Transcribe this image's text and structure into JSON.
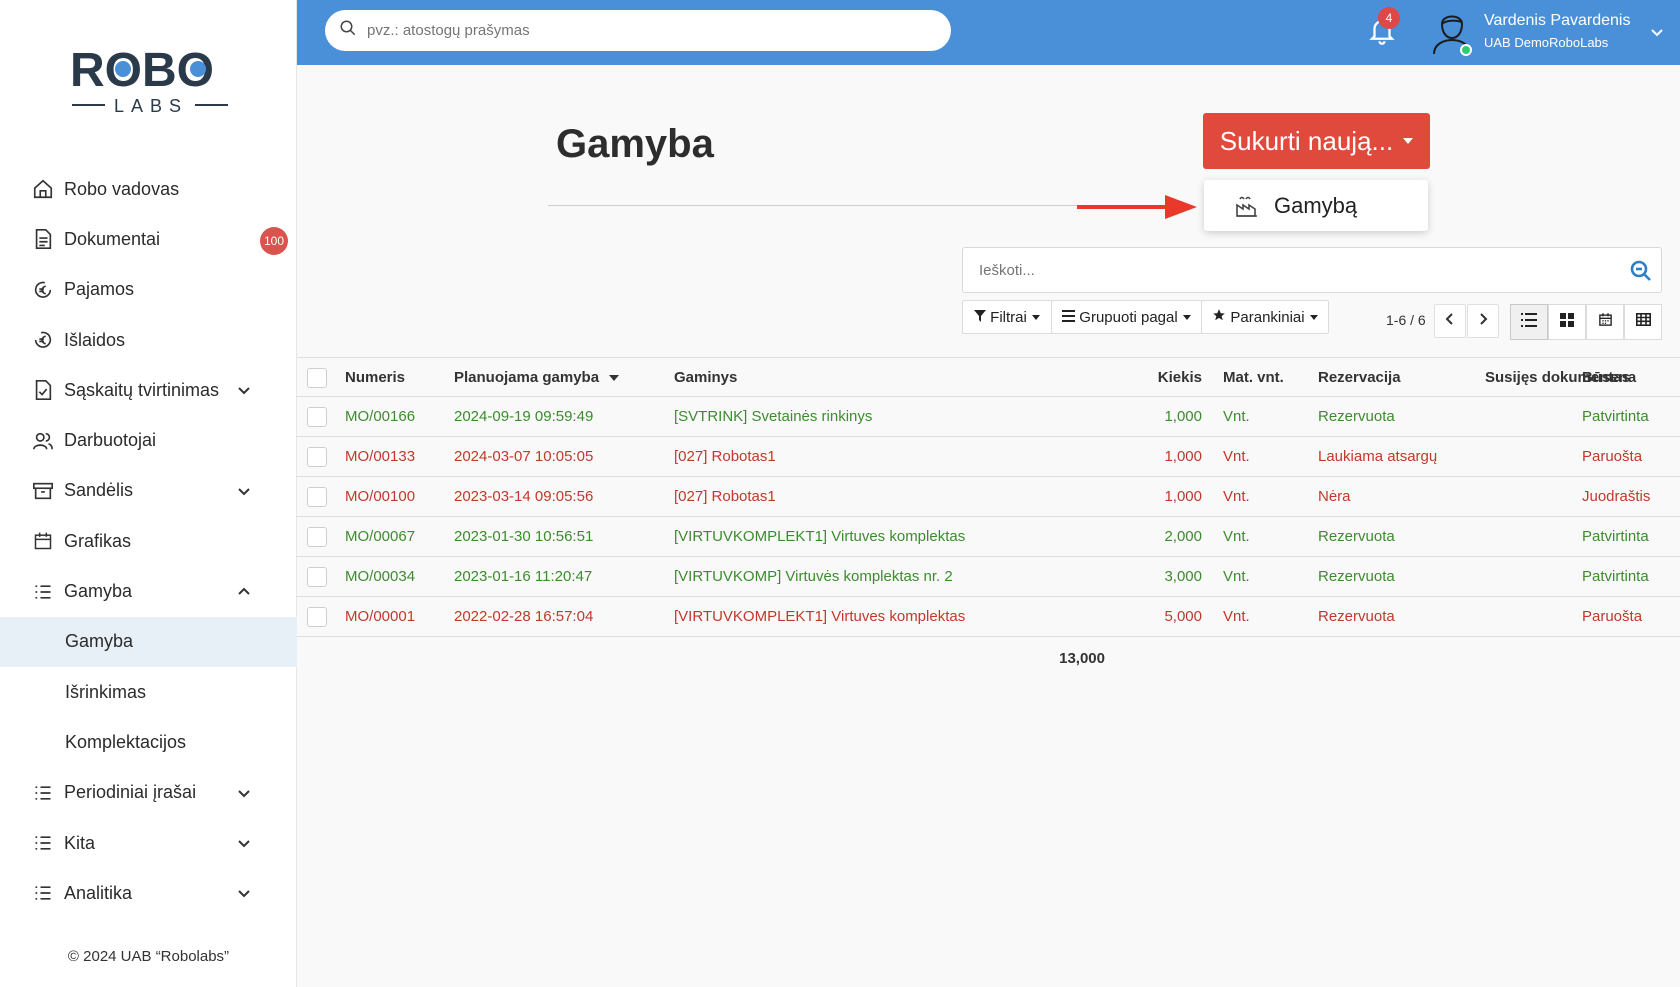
{
  "brand": {
    "logo_top": "ROBO",
    "logo_bottom": "LABS"
  },
  "sidebar": {
    "items": [
      {
        "label": "Robo vadovas",
        "icon": "home-icon"
      },
      {
        "label": "Dokumentai",
        "icon": "document-icon",
        "badge": "100"
      },
      {
        "label": "Pajamos",
        "icon": "euro-in-icon"
      },
      {
        "label": "Išlaidos",
        "icon": "euro-out-icon"
      },
      {
        "label": "Sąskaitų tvirtinimas",
        "icon": "file-check-icon",
        "expandable": true
      },
      {
        "label": "Darbuotojai",
        "icon": "users-icon"
      },
      {
        "label": "Sandėlis",
        "icon": "archive-icon",
        "expandable": true
      },
      {
        "label": "Grafikas",
        "icon": "calendar-icon"
      },
      {
        "label": "Gamyba",
        "icon": "list-icon",
        "expanded": true
      },
      {
        "label": "Gamyba",
        "sub": true,
        "active": true
      },
      {
        "label": "Išrinkimas",
        "sub": true
      },
      {
        "label": "Komplektacijos",
        "sub": true
      },
      {
        "label": "Periodiniai įrašai",
        "icon": "list-icon",
        "expandable": true
      },
      {
        "label": "Kita",
        "icon": "list-icon",
        "expandable": true
      },
      {
        "label": "Analitika",
        "icon": "list-icon",
        "expandable": true
      }
    ],
    "footer": "© 2024 UAB “Robolabs”"
  },
  "topbar": {
    "search_placeholder": "pvz.: atostogų prašymas",
    "notifications": "4",
    "user_name": "Vardenis Pavardenis",
    "user_company": "UAB DemoRoboLabs"
  },
  "page": {
    "title": "Gamyba",
    "create_button": "Sukurti naują...",
    "dropdown_item": "Gamybą",
    "search_placeholder": "Ieškoti...",
    "filters": "Filtrai",
    "group_by": "Grupuoti pagal",
    "favorites": "Parankiniai",
    "pager": "1-6 / 6"
  },
  "table": {
    "headers": {
      "number": "Numeris",
      "planned": "Planuojama gamyba",
      "product": "Gaminys",
      "qty": "Kiekis",
      "uom": "Mat. vnt.",
      "reservation": "Rezervacija",
      "related": "Susijęs dokumentas",
      "status": "Būsena"
    },
    "rows": [
      {
        "number": "MO/00166",
        "planned": "2024-09-19 09:59:49",
        "product": "[SVTRINK] Svetainės rinkinys",
        "qty": "1,000",
        "uom": "Vnt.",
        "reservation": "Rezervuota",
        "related": "",
        "status": "Patvirtinta",
        "color": "green"
      },
      {
        "number": "MO/00133",
        "planned": "2024-03-07 10:05:05",
        "product": "[027] Robotas1",
        "qty": "1,000",
        "uom": "Vnt.",
        "reservation": "Laukiama atsargų",
        "related": "",
        "status": "Paruošta",
        "color": "red"
      },
      {
        "number": "MO/00100",
        "planned": "2023-03-14 09:05:56",
        "product": "[027] Robotas1",
        "qty": "1,000",
        "uom": "Vnt.",
        "reservation": "Nėra",
        "related": "",
        "status": "Juodraštis",
        "color": "red"
      },
      {
        "number": "MO/00067",
        "planned": "2023-01-30 10:56:51",
        "product": "[VIRTUVKOMPLEKT1] Virtuves komplektas",
        "qty": "2,000",
        "uom": "Vnt.",
        "reservation": "Rezervuota",
        "related": "",
        "status": "Patvirtinta",
        "color": "green"
      },
      {
        "number": "MO/00034",
        "planned": "2023-01-16 11:20:47",
        "product": "[VIRTUVKOMP] Virtuvės komplektas nr. 2",
        "qty": "3,000",
        "uom": "Vnt.",
        "reservation": "Rezervuota",
        "related": "",
        "status": "Patvirtinta",
        "color": "green"
      },
      {
        "number": "MO/00001",
        "planned": "2022-02-28 16:57:04",
        "product": "[VIRTUVKOMPLEKT1] Virtuves komplektas",
        "qty": "5,000",
        "uom": "Vnt.",
        "reservation": "Rezervuota",
        "related": "",
        "status": "Paruošta",
        "color": "red"
      }
    ],
    "total": "13,000"
  },
  "colors": {
    "accent": "#4a90d9",
    "create": "#e04a3c",
    "green": "#3c8c2e",
    "red": "#c0392b"
  }
}
